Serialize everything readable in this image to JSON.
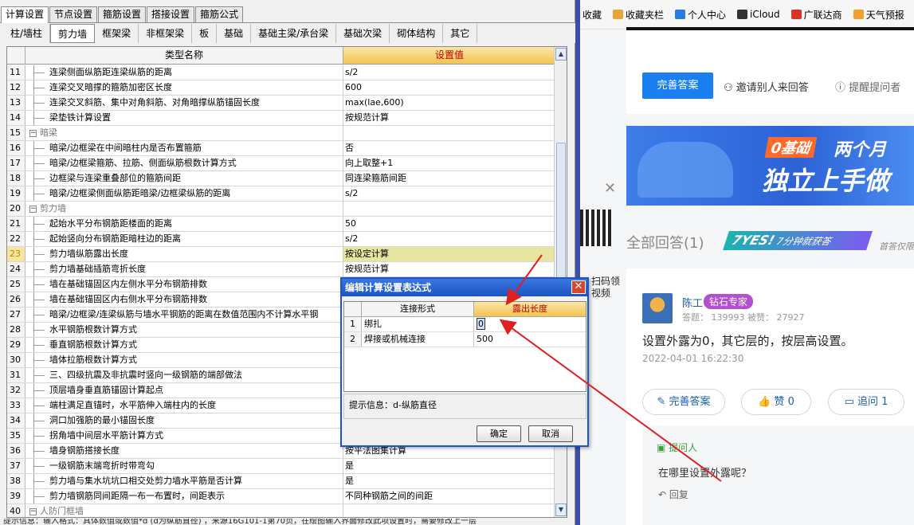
{
  "tabs_top": [
    "计算设置",
    "节点设置",
    "箍筋设置",
    "搭接设置",
    "箍筋公式"
  ],
  "tabs_sub": [
    "柱/墙柱",
    "剪力墙",
    "框架梁",
    "非框架梁",
    "板",
    "基础",
    "基础主梁/承台梁",
    "基础次梁",
    "砌体结构",
    "其它"
  ],
  "grid": {
    "col_name": "类型名称",
    "col_value": "设置值",
    "rows": [
      {
        "n": "11",
        "name": "连梁侧面纵筋距连梁纵筋的距离",
        "value": "s/2"
      },
      {
        "n": "12",
        "name": "连梁交叉暗撑的箍筋加密区长度",
        "value": "600"
      },
      {
        "n": "13",
        "name": "连梁交叉斜筋、集中对角斜筋、对角暗撑纵筋锚固长度",
        "value": "max(lae,600)"
      },
      {
        "n": "14",
        "name": "梁垫铁计算设置",
        "value": "按规范计算"
      },
      {
        "n": "15",
        "name": "暗梁",
        "value": "",
        "group": true
      },
      {
        "n": "16",
        "name": "暗梁/边框梁在中间暗柱内是否布置箍筋",
        "value": "否"
      },
      {
        "n": "17",
        "name": "暗梁/边框梁箍筋、拉筋、侧面纵筋根数计算方式",
        "value": "向上取整+1"
      },
      {
        "n": "18",
        "name": "边框梁与连梁重叠部位的箍筋间距",
        "value": "同连梁箍筋间距"
      },
      {
        "n": "19",
        "name": "暗梁/边框梁侧面纵筋距暗梁/边框梁纵筋的距离",
        "value": "s/2"
      },
      {
        "n": "20",
        "name": "剪力墙",
        "value": "",
        "group": true
      },
      {
        "n": "21",
        "name": "起始水平分布钢筋距楼面的距离",
        "value": "50"
      },
      {
        "n": "22",
        "name": "起始竖向分布钢筋距暗柱边的距离",
        "value": "s/2"
      },
      {
        "n": "23",
        "name": "剪力墙纵筋露出长度",
        "value": "按设定计算",
        "selected": true
      },
      {
        "n": "24",
        "name": "剪力墙基础插筋弯折长度",
        "value": "按规范计算"
      },
      {
        "n": "25",
        "name": "墙在基础锚固区内左侧水平分布钢筋排数",
        "value": ""
      },
      {
        "n": "26",
        "name": "墙在基础锚固区内右侧水平分布钢筋排数",
        "value": ""
      },
      {
        "n": "27",
        "name": "暗梁/边框梁/连梁纵筋与墙水平钢筋的距离在数值范围内不计算水平钢",
        "value": ""
      },
      {
        "n": "28",
        "name": "水平钢筋根数计算方式",
        "value": ""
      },
      {
        "n": "29",
        "name": "垂直钢筋根数计算方式",
        "value": ""
      },
      {
        "n": "30",
        "name": "墙体拉筋根数计算方式",
        "value": ""
      },
      {
        "n": "31",
        "name": "三、四级抗震及非抗震时竖向一级钢筋的端部做法",
        "value": ""
      },
      {
        "n": "32",
        "name": "顶层墙身垂直筋锚固计算起点",
        "value": ""
      },
      {
        "n": "33",
        "name": "端柱满足直锚时，水平筋伸入端柱内的长度",
        "value": ""
      },
      {
        "n": "34",
        "name": "洞口加强筋的最小锚固长度",
        "value": ""
      },
      {
        "n": "35",
        "name": "拐角墙中间层水平筋计算方式",
        "value": ""
      },
      {
        "n": "36",
        "name": "墙身钢筋搭接长度",
        "value": "按平法图集计算"
      },
      {
        "n": "37",
        "name": "一级钢筋末端弯折时带弯勾",
        "value": "是"
      },
      {
        "n": "38",
        "name": "剪力墙与集水坑坑口相交处剪力墙水平筋是否计算",
        "value": "是"
      },
      {
        "n": "39",
        "name": "剪力墙钢筋同间距隔一布一布置时，间距表示",
        "value": "不同种钢筋之间的间距"
      },
      {
        "n": "40",
        "name": "人防门框墙",
        "value": "",
        "group": true
      }
    ]
  },
  "hint_bar": "提示信息：输入格式：具体数值或数值*d (d为纵筋直径) ，来源16G101-1第70页，在绘图输入界面修改此项设置时，需要修改上一层",
  "dialog": {
    "title": "编辑计算设置表达式",
    "col_a": "连接形式",
    "col_b": "露出长度",
    "rows": [
      {
        "n": "1",
        "type": "绑扎",
        "value": "0"
      },
      {
        "n": "2",
        "type": "焊接或机械连接",
        "value": "500"
      }
    ],
    "tip": "提示信息：d-纵筋直径",
    "ok": "确定",
    "cancel": "取消"
  },
  "browser": {
    "bookmarks": [
      "收藏",
      "收藏夹栏",
      "个人中心",
      "iCloud",
      "广联达商",
      "天气预报"
    ],
    "answer_btn": "完善答案",
    "invite": "邀请别人来回答",
    "remind": "提醒提问者",
    "banner_tag": "0基础",
    "banner_t1": "两个月",
    "banner_t2": "独立上手做",
    "qr_text": "扫码领\n视频",
    "all_answers": "全部回答(1)",
    "yes_badge": "7YES!",
    "yes_text": "7分钟就获答",
    "only_you": "首答仅限",
    "user": "陈工",
    "badge": "钻石专家",
    "stats": "答题： 139993   被赞： 27927",
    "answer": "设置外露为0，其它层的，按层高设置。",
    "time": "2022-04-01 16:22:30",
    "pill_answer": "完善答案",
    "pill_like": "赞 0",
    "pill_ask": "追问 1",
    "asker": "提问人",
    "question": "在哪里设置外露呢？",
    "reply": "回复"
  },
  "colors": {
    "accent": "#1a7ff0",
    "header_gold": "#f3c44f",
    "dialog_blue": "#1d55c9",
    "arrow_red": "#e02020"
  }
}
